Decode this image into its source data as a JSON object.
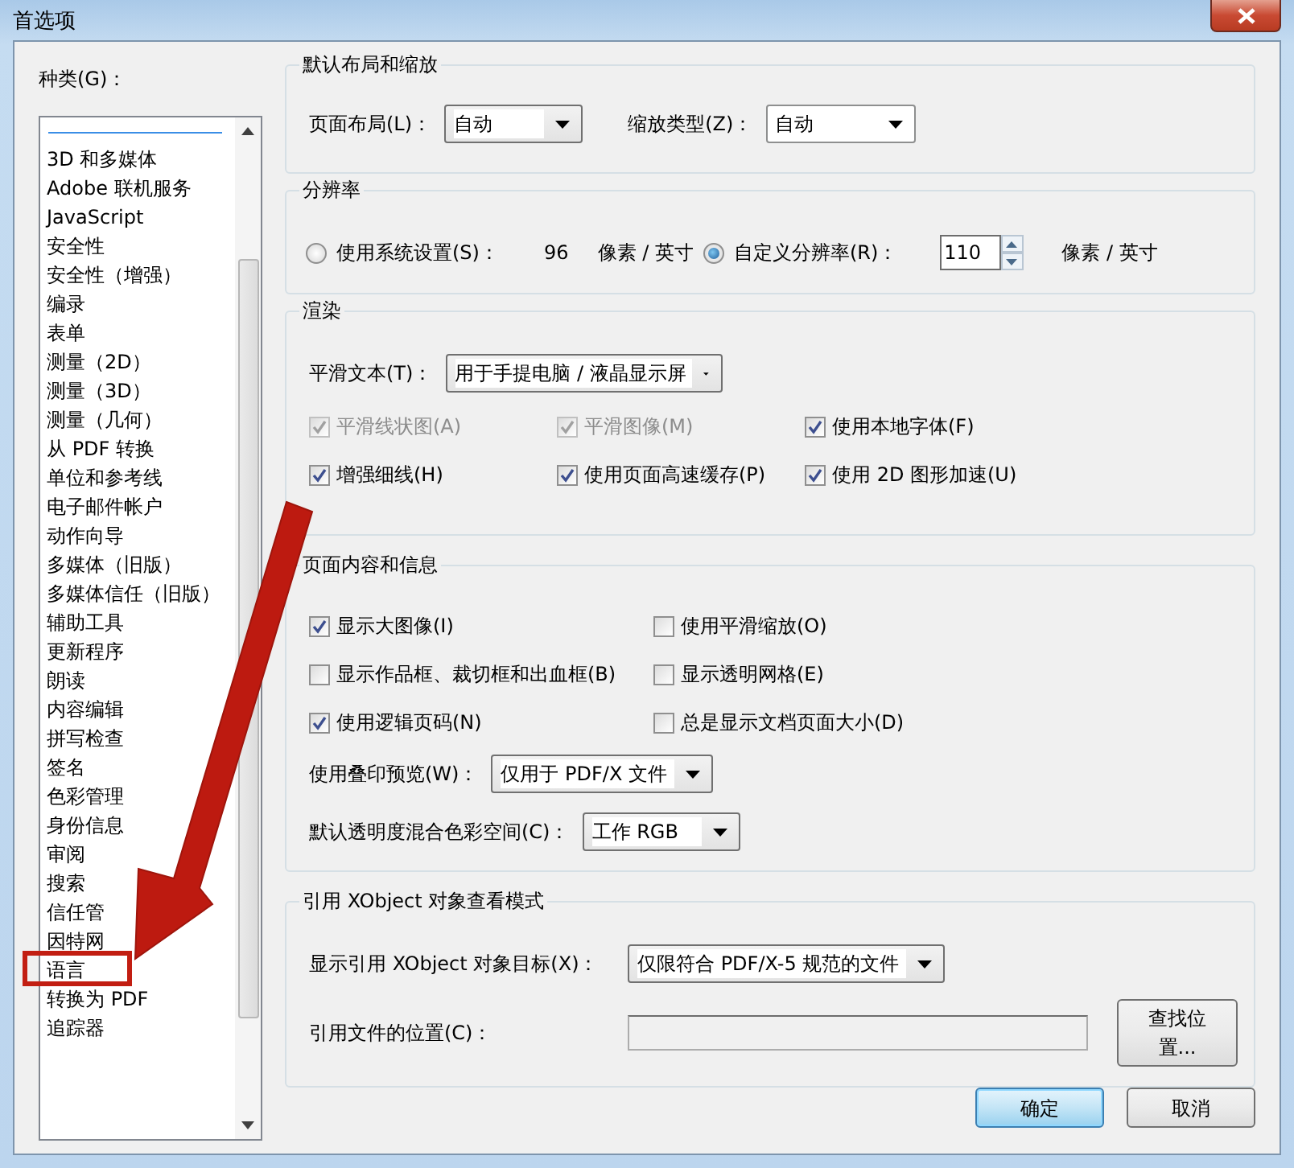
{
  "window": {
    "title": "首选项"
  },
  "categories": {
    "label": "种类(G)：",
    "items": [
      {
        "label": "3D 和多媒体"
      },
      {
        "label": "Adobe 联机服务"
      },
      {
        "label": "JavaScript"
      },
      {
        "label": "安全性"
      },
      {
        "label": "安全性（增强）"
      },
      {
        "label": "编录"
      },
      {
        "label": "表单"
      },
      {
        "label": "测量（2D）"
      },
      {
        "label": "测量（3D）"
      },
      {
        "label": "测量（几何）"
      },
      {
        "label": "从 PDF 转换"
      },
      {
        "label": "单位和参考线"
      },
      {
        "label": "电子邮件帐户"
      },
      {
        "label": "动作向导"
      },
      {
        "label": "多媒体（旧版）"
      },
      {
        "label": "多媒体信任（旧版）"
      },
      {
        "label": "辅助工具"
      },
      {
        "label": "更新程序"
      },
      {
        "label": "朗读"
      },
      {
        "label": "内容编辑"
      },
      {
        "label": "拼写检查"
      },
      {
        "label": "签名"
      },
      {
        "label": "色彩管理"
      },
      {
        "label": "身份信息"
      },
      {
        "label": "审阅"
      },
      {
        "label": "搜索"
      },
      {
        "label": "信任管"
      },
      {
        "label": "因特网"
      },
      {
        "label": "语言"
      },
      {
        "label": "转换为 PDF"
      },
      {
        "label": "追踪器"
      }
    ]
  },
  "layout_group": {
    "title": "默认布局和缩放",
    "fields": [
      {
        "label": "页面布局(L)：",
        "value": "自动"
      },
      {
        "label": "缩放类型(Z)：",
        "value": "自动"
      }
    ]
  },
  "resolution_group": {
    "title": "分辨率",
    "options": [
      {
        "kind": "static",
        "label": "使用系统设置(S)：",
        "selected": false,
        "value": "96",
        "unit": "像素 / 英寸"
      },
      {
        "kind": "spinner",
        "label": "自定义分辨率(R)：",
        "selected": true,
        "value": "110",
        "unit": "像素 / 英寸"
      }
    ]
  },
  "rendering_group": {
    "title": "渲染",
    "smooth_text": {
      "label": "平滑文本(T)：",
      "value": "用于手提电脑 / 液晶显示屏"
    },
    "checkboxes": [
      {
        "label": "平滑线状图(A)",
        "checked": true,
        "disabled": true
      },
      {
        "label": "平滑图像(M)",
        "checked": true,
        "disabled": true
      },
      {
        "label": "使用本地字体(F)",
        "checked": true,
        "disabled": false
      },
      {
        "label": "增强细线(H)",
        "checked": true,
        "disabled": false
      },
      {
        "label": "使用页面高速缓存(P)",
        "checked": true,
        "disabled": false
      },
      {
        "label": "使用 2D 图形加速(U)",
        "checked": true,
        "disabled": false
      }
    ]
  },
  "page_content_group": {
    "title": "页面内容和信息",
    "checkboxes": [
      {
        "label": "显示大图像(I)",
        "checked": true
      },
      {
        "label": "使用平滑缩放(O)",
        "checked": false
      },
      {
        "label": "显示作品框、裁切框和出血框(B)",
        "checked": false
      },
      {
        "label": "显示透明网格(E)",
        "checked": false
      },
      {
        "label": "使用逻辑页码(N)",
        "checked": true
      },
      {
        "label": "总是显示文档页面大小(D)",
        "checked": false
      }
    ],
    "dropdowns": [
      {
        "label": "使用叠印预览(W)：",
        "value": "仅用于 PDF/X 文件"
      },
      {
        "label": "默认透明度混合色彩空间(C)：",
        "value": "工作 RGB"
      }
    ]
  },
  "xobject_group": {
    "title": "引用 XObject 对象查看模式",
    "dropdown": {
      "label": "显示引用 XObject 对象目标(X)：",
      "value": "仅限符合 PDF/X-5 规范的文件"
    },
    "location": {
      "label": "引用文件的位置(C)：",
      "button": "查找位置..."
    }
  },
  "buttons": [
    {
      "label": "确定",
      "default": true
    },
    {
      "label": "取消",
      "default": false
    }
  ]
}
